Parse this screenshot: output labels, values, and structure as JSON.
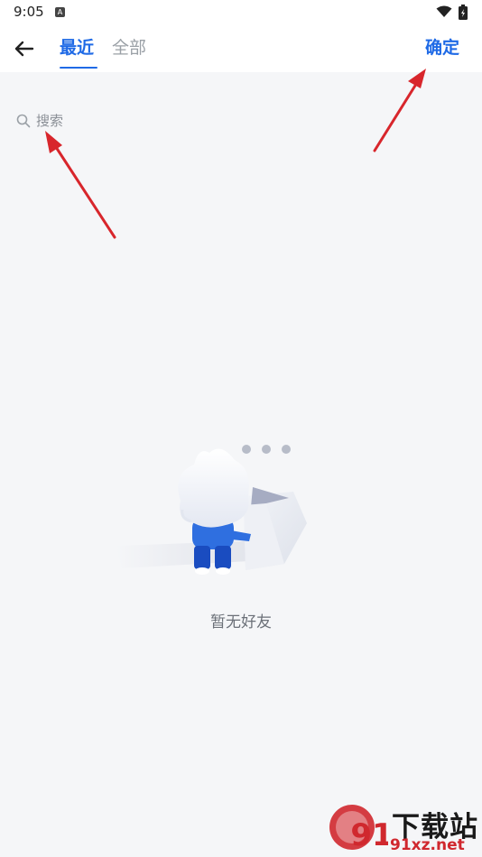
{
  "status_bar": {
    "time": "9:05",
    "app_icon": "A"
  },
  "header": {
    "tabs": [
      {
        "label": "最近",
        "active": true
      },
      {
        "label": "全部",
        "active": false
      }
    ],
    "confirm_label": "确定"
  },
  "search": {
    "placeholder": "搜索",
    "icon": "search-icon"
  },
  "empty_state": {
    "message": "暂无好友",
    "illustration": "character-with-open-box"
  },
  "annotations": {
    "arrows": [
      "red-arrow-to-confirm",
      "red-arrow-to-search"
    ]
  },
  "watermark": {
    "logo_text": "91",
    "title": "下载站",
    "url": "91xz.net"
  },
  "colors": {
    "accent": "#1f6ae6",
    "background": "#f5f6f8",
    "arrow": "#d8262c"
  }
}
